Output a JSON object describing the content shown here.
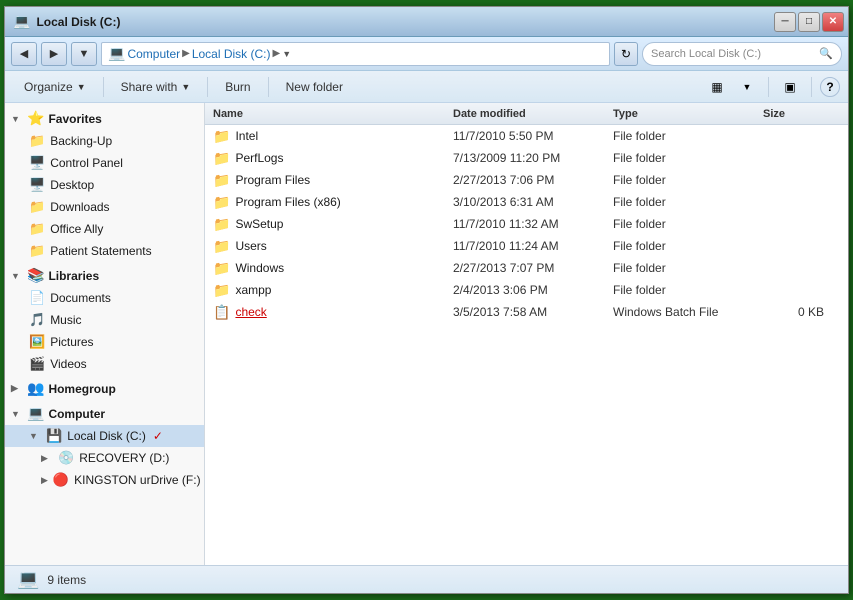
{
  "window": {
    "title": "Local Disk (C:)",
    "icon": "💻"
  },
  "titlebar": {
    "min_label": "─",
    "max_label": "□",
    "close_label": "✕"
  },
  "addressbar": {
    "back_label": "◀",
    "forward_label": "▶",
    "dropdown_label": "▼",
    "breadcrumb": [
      "Computer",
      "Local Disk (C:)",
      ""
    ],
    "refresh_label": "↻",
    "search_placeholder": "Search Local Disk (C:)",
    "search_icon": "🔍"
  },
  "toolbar": {
    "organize_label": "Organize",
    "share_label": "Share with",
    "burn_label": "Burn",
    "new_folder_label": "New folder",
    "view_icon": "▦",
    "pane_icon": "▣",
    "help_icon": "?"
  },
  "sidebar": {
    "favorites_label": "Favorites",
    "favorites_icon": "⭐",
    "favorites_items": [
      {
        "label": "Backing-Up",
        "icon": "📁"
      },
      {
        "label": "Control Panel",
        "icon": "🖥️"
      },
      {
        "label": "Desktop",
        "icon": "🖥️"
      },
      {
        "label": "Downloads",
        "icon": "📁"
      },
      {
        "label": "Office Ally",
        "icon": "📁"
      },
      {
        "label": "Patient Statements",
        "icon": "📁"
      }
    ],
    "libraries_label": "Libraries",
    "libraries_icon": "📚",
    "libraries_items": [
      {
        "label": "Documents",
        "icon": "📄"
      },
      {
        "label": "Music",
        "icon": "🎵"
      },
      {
        "label": "Pictures",
        "icon": "🖼️"
      },
      {
        "label": "Videos",
        "icon": "🎬"
      }
    ],
    "homegroup_label": "Homegroup",
    "homegroup_icon": "👥",
    "computer_label": "Computer",
    "computer_icon": "💻",
    "computer_items": [
      {
        "label": "Local Disk (C:)",
        "icon": "💾",
        "selected": true
      },
      {
        "label": "RECOVERY (D:)",
        "icon": "💿",
        "selected": false
      },
      {
        "label": "KINGSTON urDrive (F:)",
        "icon": "🔴",
        "selected": false
      }
    ]
  },
  "columns": {
    "name": "Name",
    "date_modified": "Date modified",
    "type": "Type",
    "size": "Size"
  },
  "files": [
    {
      "name": "Intel",
      "icon": "📁",
      "date": "11/7/2010 5:50 PM",
      "type": "File folder",
      "size": "",
      "is_batch": false
    },
    {
      "name": "PerfLogs",
      "icon": "📁",
      "date": "7/13/2009 11:20 PM",
      "type": "File folder",
      "size": "",
      "is_batch": false
    },
    {
      "name": "Program Files",
      "icon": "📁",
      "date": "2/27/2013 7:06 PM",
      "type": "File folder",
      "size": "",
      "is_batch": false
    },
    {
      "name": "Program Files (x86)",
      "icon": "📁",
      "date": "3/10/2013 6:31 AM",
      "type": "File folder",
      "size": "",
      "is_batch": false
    },
    {
      "name": "SwSetup",
      "icon": "📁",
      "date": "11/7/2010 11:32 AM",
      "type": "File folder",
      "size": "",
      "is_batch": false
    },
    {
      "name": "Users",
      "icon": "📁",
      "date": "11/7/2010 11:24 AM",
      "type": "File folder",
      "size": "",
      "is_batch": false
    },
    {
      "name": "Windows",
      "icon": "📁",
      "date": "2/27/2013 7:07 PM",
      "type": "File folder",
      "size": "",
      "is_batch": false
    },
    {
      "name": "xampp",
      "icon": "📁",
      "date": "2/4/2013 3:06 PM",
      "type": "File folder",
      "size": "",
      "is_batch": false
    },
    {
      "name": "check",
      "icon": "📋",
      "date": "3/5/2013 7:58 AM",
      "type": "Windows Batch File",
      "size": "0 KB",
      "is_batch": true
    }
  ],
  "status": {
    "icon": "💻",
    "items_label": "9 items"
  }
}
